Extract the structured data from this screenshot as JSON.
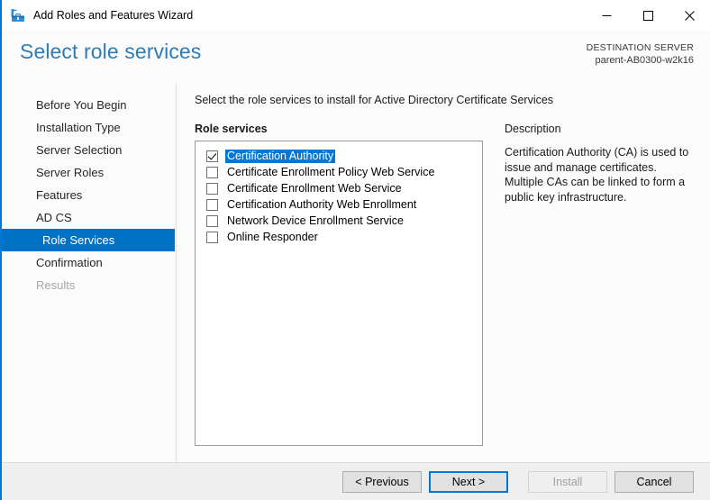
{
  "window": {
    "title": "Add Roles and Features Wizard",
    "icon": "wizard-toolbox-icon",
    "accent_color": "#0078d7",
    "caption": {
      "minimize": "minimize-icon",
      "maximize": "maximize-icon",
      "close": "close-icon"
    }
  },
  "header": {
    "page_title": "Select role services",
    "destination_label": "DESTINATION SERVER",
    "destination_server": "parent-AB0300-w2k16",
    "title_color": "#2e7cb8"
  },
  "sidebar": {
    "items": [
      {
        "label": "Before You Begin",
        "state": "normal",
        "sub": false
      },
      {
        "label": "Installation Type",
        "state": "normal",
        "sub": false
      },
      {
        "label": "Server Selection",
        "state": "normal",
        "sub": false
      },
      {
        "label": "Server Roles",
        "state": "normal",
        "sub": false
      },
      {
        "label": "Features",
        "state": "normal",
        "sub": false
      },
      {
        "label": "AD CS",
        "state": "normal",
        "sub": false
      },
      {
        "label": "Role Services",
        "state": "selected",
        "sub": true
      },
      {
        "label": "Confirmation",
        "state": "normal",
        "sub": false
      },
      {
        "label": "Results",
        "state": "disabled",
        "sub": false
      }
    ],
    "selected_color": "#0072c6"
  },
  "main": {
    "intro": "Select the role services to install for Active Directory Certificate Services",
    "role_services_label": "Role services",
    "selection_color": "#0078d7",
    "role_services": [
      {
        "label": "Certification Authority",
        "checked": true,
        "selected": true
      },
      {
        "label": "Certificate Enrollment Policy Web Service",
        "checked": false,
        "selected": false
      },
      {
        "label": "Certificate Enrollment Web Service",
        "checked": false,
        "selected": false
      },
      {
        "label": "Certification Authority Web Enrollment",
        "checked": false,
        "selected": false
      },
      {
        "label": "Network Device Enrollment Service",
        "checked": false,
        "selected": false
      },
      {
        "label": "Online Responder",
        "checked": false,
        "selected": false
      }
    ]
  },
  "description": {
    "title": "Description",
    "text": "Certification Authority (CA) is used to issue and manage certificates. Multiple CAs can be linked to form a public key infrastructure."
  },
  "footer": {
    "previous": "< Previous",
    "next": "Next >",
    "install": "Install",
    "cancel": "Cancel"
  }
}
